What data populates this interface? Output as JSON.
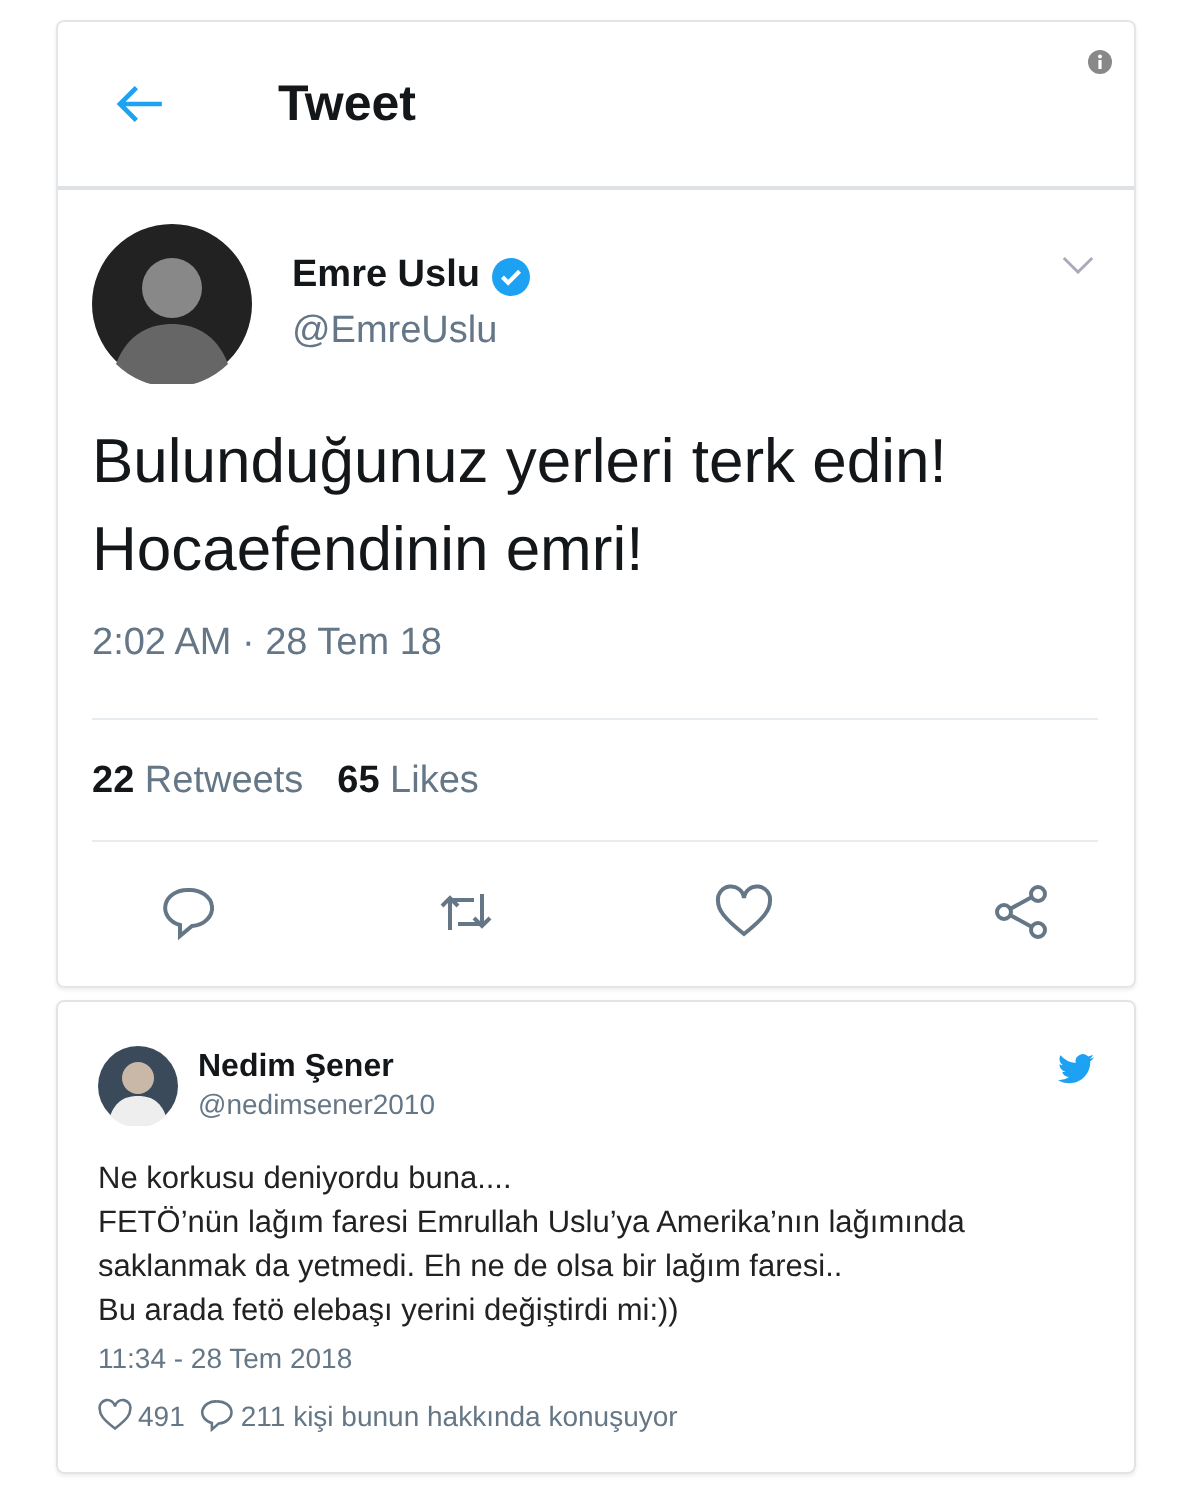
{
  "header": {
    "title": "Tweet"
  },
  "tweet": {
    "name": "Emre Uslu",
    "verified": true,
    "handle": "@EmreUslu",
    "text": [
      "Bulunduğunuz yerleri terk edin!",
      "Hocaefendinin emri!"
    ],
    "time": "2:02 AM · 28 Tem 18",
    "stats": [
      {
        "count": "22",
        "label": "Retweets"
      },
      {
        "count": "65",
        "label": "Likes"
      }
    ]
  },
  "reply": {
    "name": "Nedim Şener",
    "handle": "@nedimsener2010",
    "text": [
      "Ne korkusu deniyordu buna....",
      "FETÖ’nün lağım faresi Emrullah Uslu’ya Amerika’nın lağımında saklanmak da yetmedi. Eh ne de olsa bir lağım faresi..",
      "Bu arada fetö elebaşı yerini değiştirdi mi:))"
    ],
    "time": "11:34 - 28 Tem 2018",
    "likes": "491",
    "talk": "211 kişi bunun hakkında konuşuyor"
  }
}
